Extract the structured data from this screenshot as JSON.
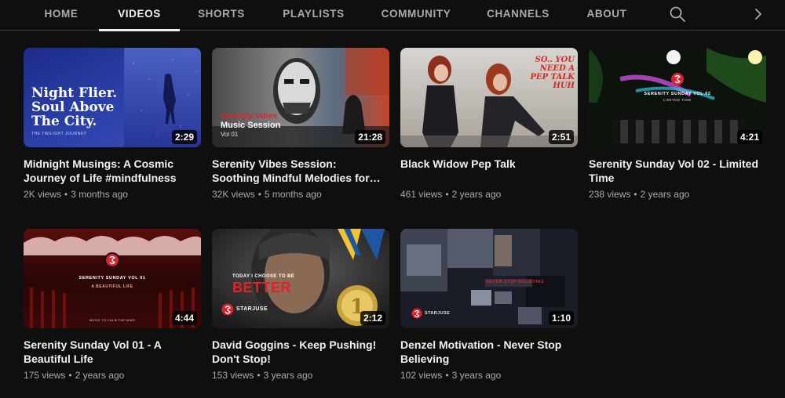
{
  "tabs": [
    {
      "label": "HOME",
      "active": false
    },
    {
      "label": "VIDEOS",
      "active": true
    },
    {
      "label": "SHORTS",
      "active": false
    },
    {
      "label": "PLAYLISTS",
      "active": false
    },
    {
      "label": "COMMUNITY",
      "active": false
    },
    {
      "label": "CHANNELS",
      "active": false
    },
    {
      "label": "ABOUT",
      "active": false
    }
  ],
  "icons": {
    "search": "search-icon",
    "next": "chevron-right-icon"
  },
  "colors": {
    "background": "#0f0f0f",
    "text_primary": "#f1f1f1",
    "text_secondary": "#aaaaaa",
    "brand_red": "#d9222a"
  },
  "videos": [
    {
      "title": "Midnight Musings: A Cosmic Journey of Life #mindfulness",
      "duration": "2:29",
      "views": "2K views",
      "age": "3 months ago",
      "thumb_text": {
        "line1": "Night Flier.",
        "line2": "Soul Above",
        "line3": "The City.",
        "caption": "THE TWILIGHT JOURNEY"
      }
    },
    {
      "title": "Serenity Vibes Session: Soothing Mindful Melodies for Work & Focu...",
      "duration": "21:28",
      "views": "32K views",
      "age": "5 months ago",
      "thumb_text": {
        "line1": "Serenity Vibes",
        "line2": "Music Session",
        "line3": "Vol 01"
      }
    },
    {
      "title": "Black Widow Pep Talk",
      "duration": "2:51",
      "views": "461 views",
      "age": "2 years ago",
      "thumb_text": {
        "line1": "SO.. YOU",
        "line2": "NEED A",
        "line3": "PEP TALK",
        "line4": "HUH"
      }
    },
    {
      "title": "Serenity Sunday Vol 02 - Limited Time",
      "duration": "4:21",
      "views": "238 views",
      "age": "2 years ago",
      "thumb_text": {
        "line1": "SERENITY SUNDAY VOL 02",
        "line2": "LIMITED TIME"
      }
    },
    {
      "title": "Serenity Sunday Vol 01 - A Beautiful Life",
      "duration": "4:44",
      "views": "175 views",
      "age": "2 years ago",
      "thumb_text": {
        "line1": "SERENITY SUNDAY VOL 01",
        "line2": "A BEAUTIFUL LIFE",
        "line3": "MUSIC TO CALM THE MIND"
      }
    },
    {
      "title": "David Goggins - Keep Pushing! Don't Stop!",
      "duration": "2:12",
      "views": "153 views",
      "age": "3 years ago",
      "thumb_text": {
        "line1": "TODAY I CHOOSE TO BE",
        "line2": "BETTER",
        "brand": "STARJUSE"
      }
    },
    {
      "title": "Denzel Motivation - Never Stop Believing",
      "duration": "1:10",
      "views": "102 views",
      "age": "3 years ago",
      "thumb_text": {
        "line1": "NEVER STOP BELIEVING",
        "brand": "STARJUSE"
      }
    }
  ]
}
